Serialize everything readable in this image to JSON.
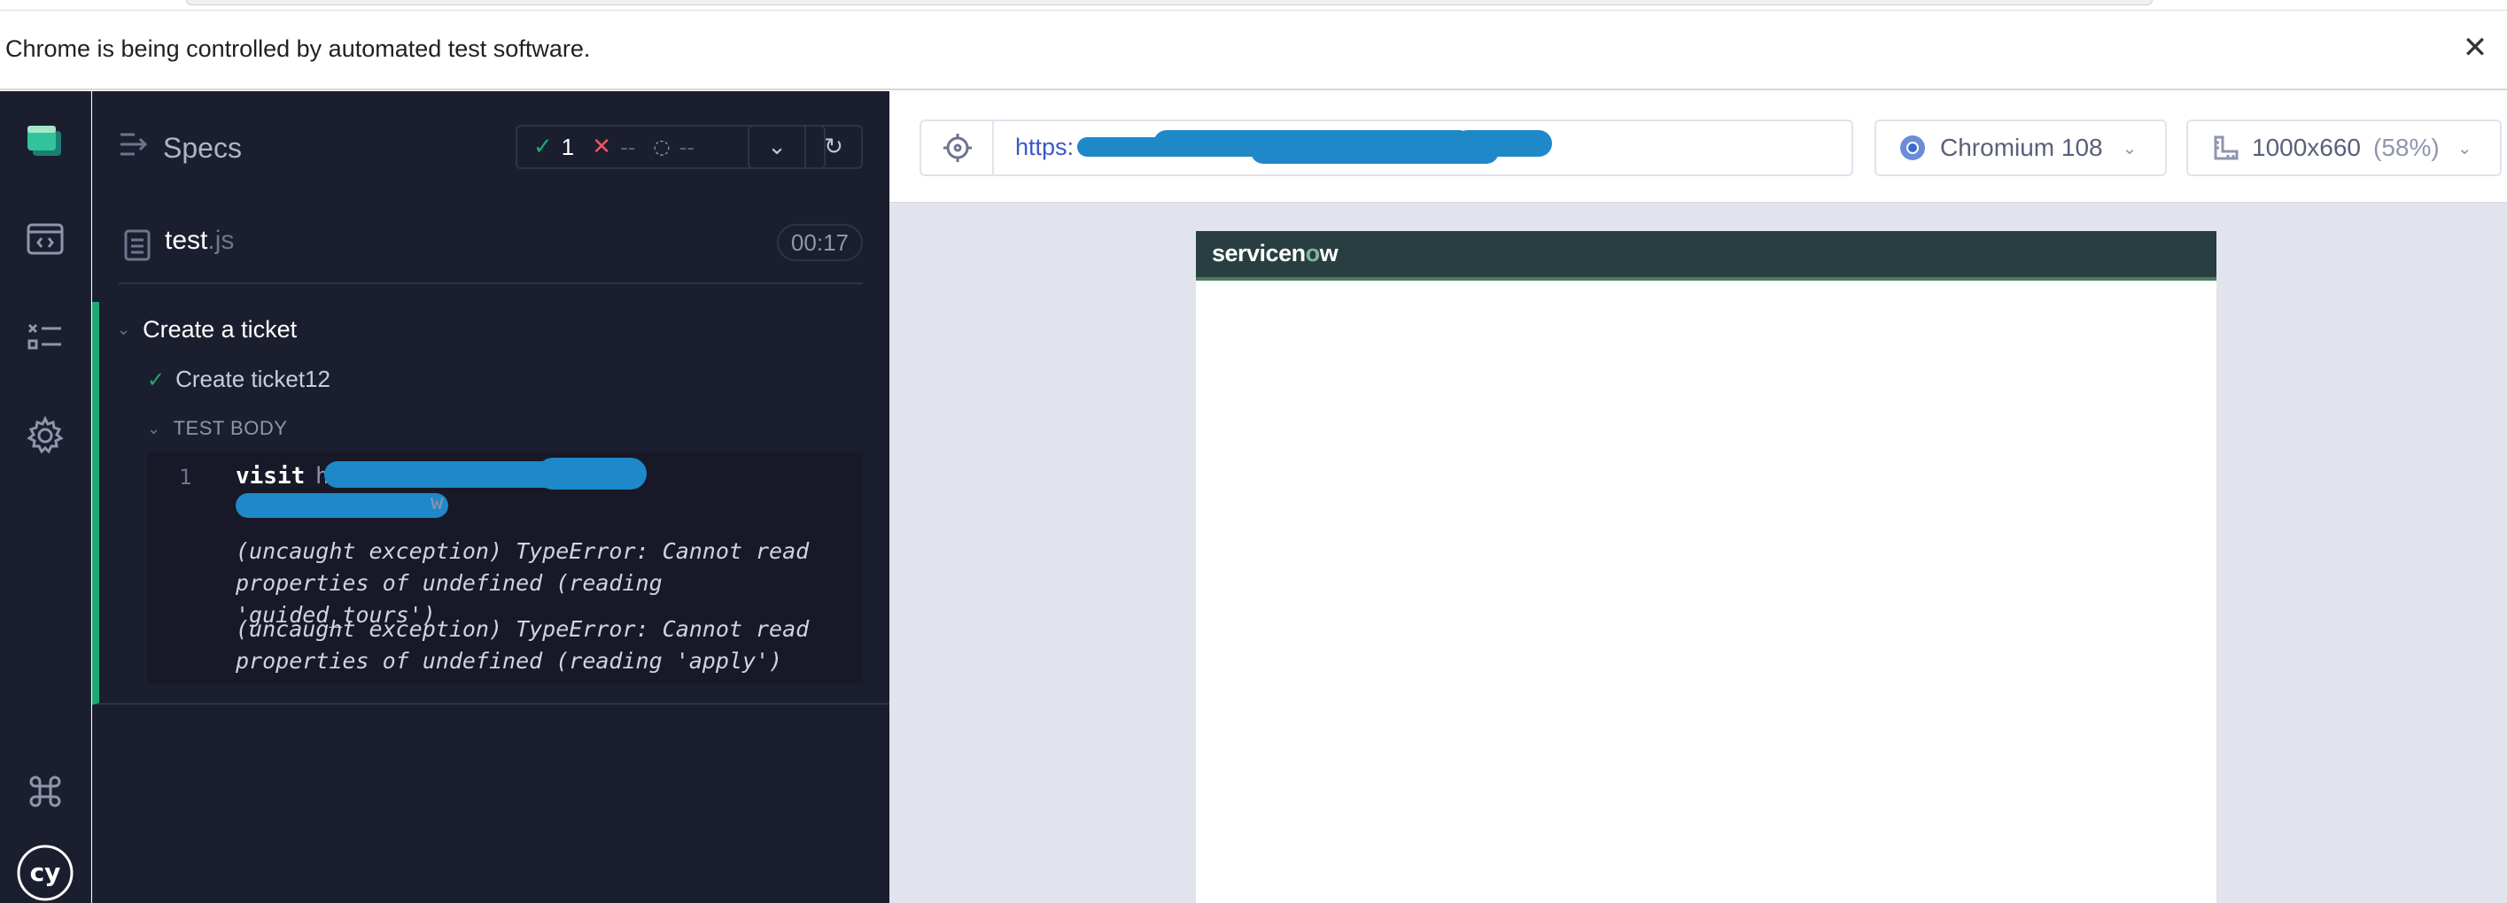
{
  "infobar": {
    "message": "Chrome is being controlled by automated test software.",
    "close_glyph": "✕"
  },
  "rail": {
    "icons": [
      "cypress-app-icon",
      "specs-list-icon",
      "runs-icon",
      "settings-icon",
      "keyboard-shortcuts-icon",
      "cypress-logo-icon"
    ],
    "logo_text": "cy"
  },
  "reporter": {
    "specs_label": "Specs",
    "stats": {
      "passed": "1",
      "failed": "--",
      "pending": "--"
    },
    "file": {
      "name": "test",
      "ext": ".js",
      "duration": "00:17"
    },
    "suite": {
      "title": "Create a ticket"
    },
    "test": {
      "title": "Create ticket12",
      "hook": "TEST BODY"
    },
    "command": {
      "number": "1",
      "name": "visit",
      "url_visible": "h",
      "url_line2_suffix": "w"
    },
    "errors": [
      "(uncaught exception)  TypeError: Cannot read properties of undefined (reading 'guided_tours')",
      "(uncaught exception)  TypeError: Cannot read properties of undefined (reading 'apply')"
    ]
  },
  "aut": {
    "url": "https:",
    "browser": "Chromium 108",
    "viewport": "1000x660",
    "scale": "(58%)",
    "app_logo": {
      "main": "servicen",
      "o": "o",
      "tail": "w"
    }
  },
  "colors": {
    "reporter_bg": "#1b1e2e",
    "passed": "#1fa971",
    "failed": "#f1545d",
    "servicenow_bar": "#293e40"
  }
}
